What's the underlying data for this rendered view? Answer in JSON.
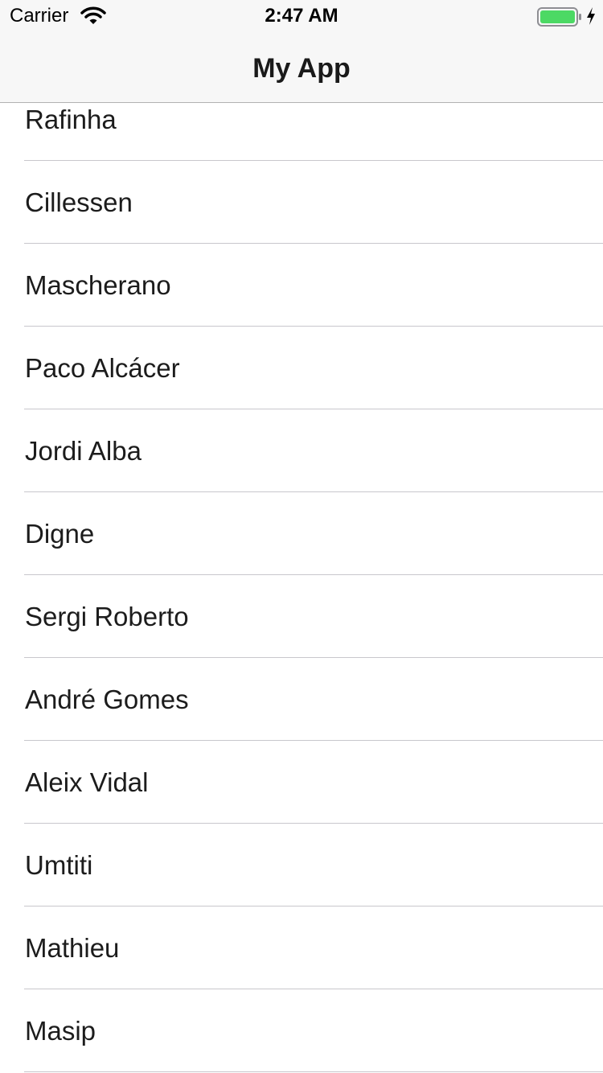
{
  "status_bar": {
    "carrier": "Carrier",
    "time": "2:47 AM",
    "battery_level": 1.0,
    "battery_color": "#4cd964",
    "charging": true
  },
  "nav_bar": {
    "title": "My App"
  },
  "list": {
    "items": [
      "Rafinha",
      "Cillessen",
      "Mascherano",
      "Paco Alcácer",
      "Jordi Alba",
      "Digne",
      "Sergi Roberto",
      "André Gomes",
      "Aleix Vidal",
      "Umtiti",
      "Mathieu",
      "Masip"
    ]
  },
  "colors": {
    "nav_background": "#f7f7f7",
    "separator": "#c8c7cc",
    "text": "#1c1c1c"
  }
}
